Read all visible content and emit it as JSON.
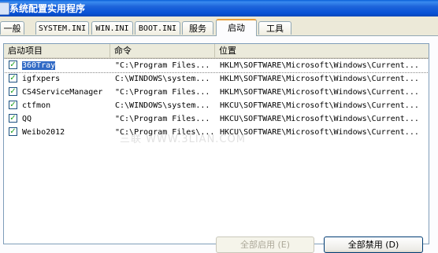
{
  "window": {
    "title": "系统配置实用程序"
  },
  "tabs": [
    {
      "label": "一般"
    },
    {
      "label": "SYSTEM.INI"
    },
    {
      "label": "WIN.INI"
    },
    {
      "label": "BOOT.INI"
    },
    {
      "label": "服务"
    },
    {
      "label": "启动",
      "active": true
    },
    {
      "label": "工具"
    }
  ],
  "startup": {
    "columns": [
      "启动项目",
      "命令",
      "位置"
    ],
    "items": [
      {
        "checked": true,
        "name": "360Tray",
        "command": "\"C:\\Program Files...",
        "location": "HKLM\\SOFTWARE\\Microsoft\\Windows\\Current...",
        "selected": true
      },
      {
        "checked": true,
        "name": "igfxpers",
        "command": "C:\\WINDOWS\\system...",
        "location": "HKLM\\SOFTWARE\\Microsoft\\Windows\\Current..."
      },
      {
        "checked": true,
        "name": "CS4ServiceManager",
        "command": "\"C:\\Program Files...",
        "location": "HKLM\\SOFTWARE\\Microsoft\\Windows\\Current..."
      },
      {
        "checked": true,
        "name": "ctfmon",
        "command": "C:\\WINDOWS\\system...",
        "location": "HKCU\\SOFTWARE\\Microsoft\\Windows\\Current..."
      },
      {
        "checked": true,
        "name": "QQ",
        "command": "\"C:\\Program Files...",
        "location": "HKCU\\SOFTWARE\\Microsoft\\Windows\\Current..."
      },
      {
        "checked": true,
        "name": "Weibo2012",
        "command": "\"C:\\Program Files\\...",
        "location": "HKCU\\SOFTWARE\\Microsoft\\Windows\\Current..."
      }
    ]
  },
  "buttons": {
    "enable_all": "全部启用 (E)",
    "disable_all": "全部禁用 (D)"
  },
  "watermark": "三联 WWW.3LIAN.COM"
}
